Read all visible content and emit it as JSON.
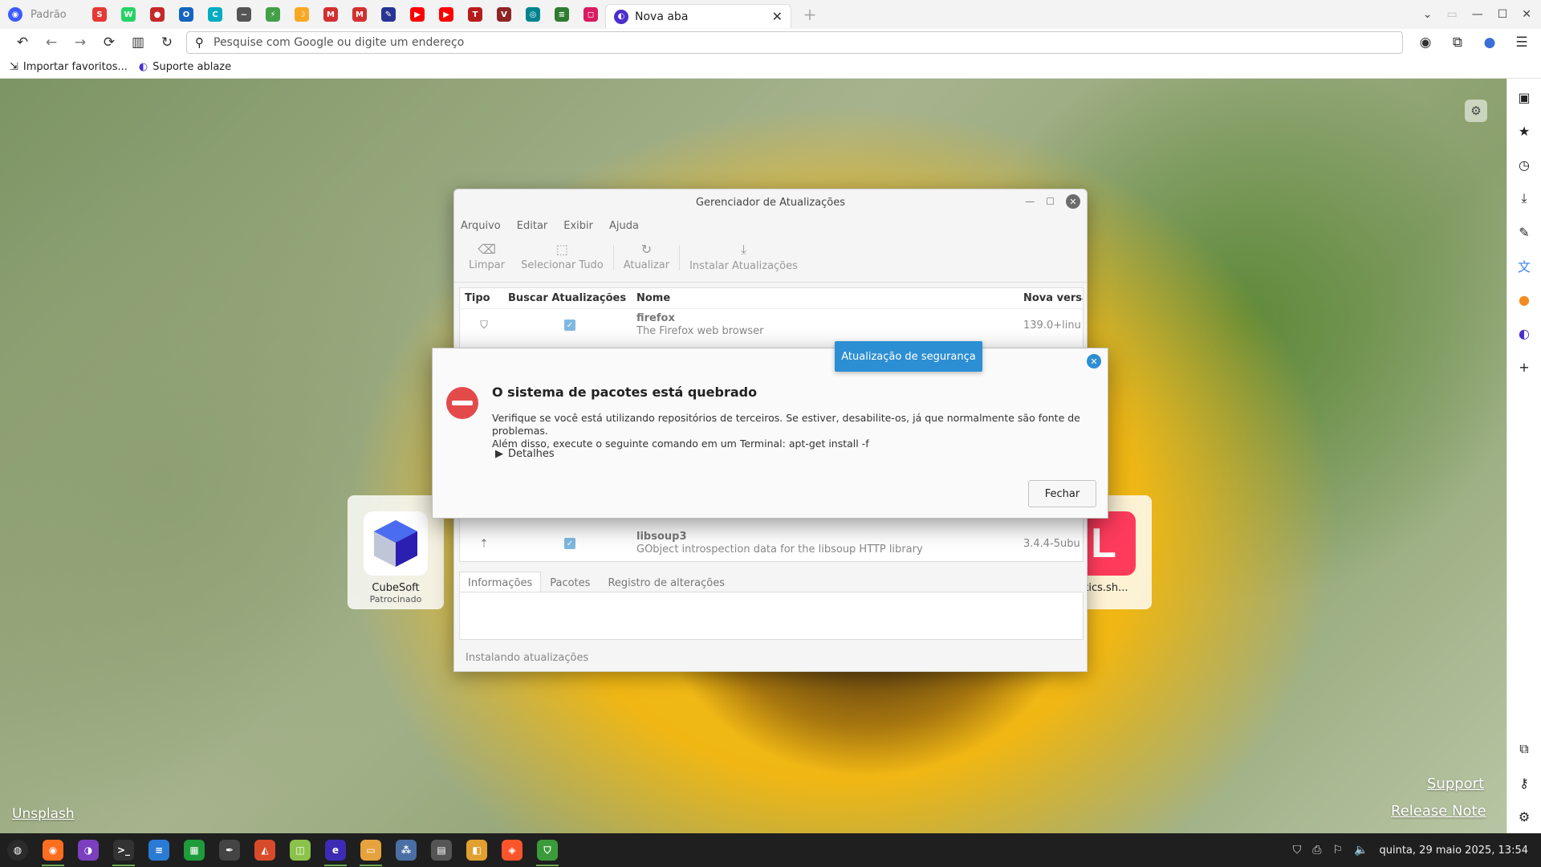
{
  "browser": {
    "profile_label": "Padrão",
    "active_tab_title": "Nova aba",
    "pinned_tabs": [
      {
        "icon": "app-icon",
        "color": "#e53935",
        "glyph": "S"
      },
      {
        "icon": "whatsapp-icon",
        "color": "#25d366",
        "glyph": "W"
      },
      {
        "icon": "red-hat-icon",
        "color": "#c62828",
        "glyph": "●"
      },
      {
        "icon": "o-icon",
        "color": "#1565c0",
        "glyph": "O"
      },
      {
        "icon": "c-icon",
        "color": "#00acc1",
        "glyph": "C"
      },
      {
        "icon": "signature-icon",
        "color": "#555555",
        "glyph": "~"
      },
      {
        "icon": "bolt-icon",
        "color": "#43a047",
        "glyph": "⚡"
      },
      {
        "icon": "moon-icon",
        "color": "#f9a825",
        "glyph": "☽"
      },
      {
        "icon": "gmail-icon",
        "color": "#d32f2f",
        "glyph": "M"
      },
      {
        "icon": "gmail-icon",
        "color": "#d32f2f",
        "glyph": "M"
      },
      {
        "icon": "pen-icon",
        "color": "#283593",
        "glyph": "✎"
      },
      {
        "icon": "youtube-icon",
        "color": "#ff0000",
        "glyph": "▶"
      },
      {
        "icon": "youtube-icon",
        "color": "#ff0000",
        "glyph": "▶"
      },
      {
        "icon": "t-icon",
        "color": "#b71c1c",
        "glyph": "T"
      },
      {
        "icon": "shield-icon",
        "color": "#8e2424",
        "glyph": "V"
      },
      {
        "icon": "circle-icon",
        "color": "#00838f",
        "glyph": "◎"
      },
      {
        "icon": "list-icon",
        "color": "#2e7d32",
        "glyph": "≡"
      },
      {
        "icon": "instagram-icon",
        "color": "#d81b60",
        "glyph": "◻"
      }
    ],
    "address_placeholder": "Pesquise com Google ou digite um endereço",
    "bookmarks": [
      "Importar favoritos...",
      "Suporte ablaze"
    ]
  },
  "newtab": {
    "shortcuts": [
      {
        "name": "CubeSoft",
        "sub": "Patrocinado"
      },
      {
        "name": "stics.sh...",
        "sub": ""
      }
    ],
    "links": {
      "left": "Unsplash",
      "support": "Support",
      "release": "Release Note"
    }
  },
  "update_manager": {
    "title": "Gerenciador de Atualizações",
    "menu": [
      "Arquivo",
      "Editar",
      "Exibir",
      "Ajuda"
    ],
    "tools": {
      "clear": "Limpar",
      "select_all": "Selecionar Tudo",
      "refresh": "Atualizar",
      "install": "Instalar Atualizações"
    },
    "columns": {
      "type": "Tipo",
      "check": "Buscar Atualizações",
      "name": "Nome",
      "version": "Nova versã"
    },
    "rows": [
      {
        "name": "firefox",
        "desc": "The Firefox web browser",
        "version": "139.0+linu"
      },
      {
        "name": "libsoup3",
        "desc": "GObject introspection data for the libsoup HTTP library",
        "version": "3.4.4-5ubu"
      }
    ],
    "tabs": [
      "Informações",
      "Pacotes",
      "Registro de alterações"
    ],
    "status": "Instalando atualizações"
  },
  "tooltip": "Atualização de segurança",
  "dialog": {
    "title": "O sistema de pacotes está quebrado",
    "message_line1": "Verifique se você está utilizando repositórios de terceiros. Se estiver, desabilite-os, já que normalmente são fonte de problemas.",
    "message_line2": "Além disso, execute o seguinte comando em um Terminal: apt-get install -f",
    "details": "Detalhes",
    "close_button": "Fechar"
  },
  "taskbar": {
    "clock": "quinta, 29 maio 2025, 13:54",
    "apps": [
      {
        "icon": "mint-menu-icon",
        "color": "#2b2b2b"
      },
      {
        "icon": "firefox-icon",
        "color": "#ff6d1f"
      },
      {
        "icon": "tor-browser-icon",
        "color": "#7b3fbf"
      },
      {
        "icon": "terminal-icon",
        "color": "#333333"
      },
      {
        "icon": "text-editor-icon",
        "color": "#2a7bd4"
      },
      {
        "icon": "spreadsheet-icon",
        "color": "#1e9b3a"
      },
      {
        "icon": "inkscape-icon",
        "color": "#444444"
      },
      {
        "icon": "gimp-icon",
        "color": "#d84b2a"
      },
      {
        "icon": "android-icon",
        "color": "#8bc34a"
      },
      {
        "icon": "ablaze-browser-icon",
        "color": "#3d2bb5"
      },
      {
        "icon": "files-icon",
        "color": "#e6a23c"
      },
      {
        "icon": "network-icon",
        "color": "#4a6fa5"
      },
      {
        "icon": "calculator-icon",
        "color": "#555555"
      },
      {
        "icon": "archive-icon",
        "color": "#e0a030"
      },
      {
        "icon": "brave-icon",
        "color": "#fb542b"
      },
      {
        "icon": "update-manager-icon",
        "color": "#3b9b3b"
      }
    ]
  }
}
